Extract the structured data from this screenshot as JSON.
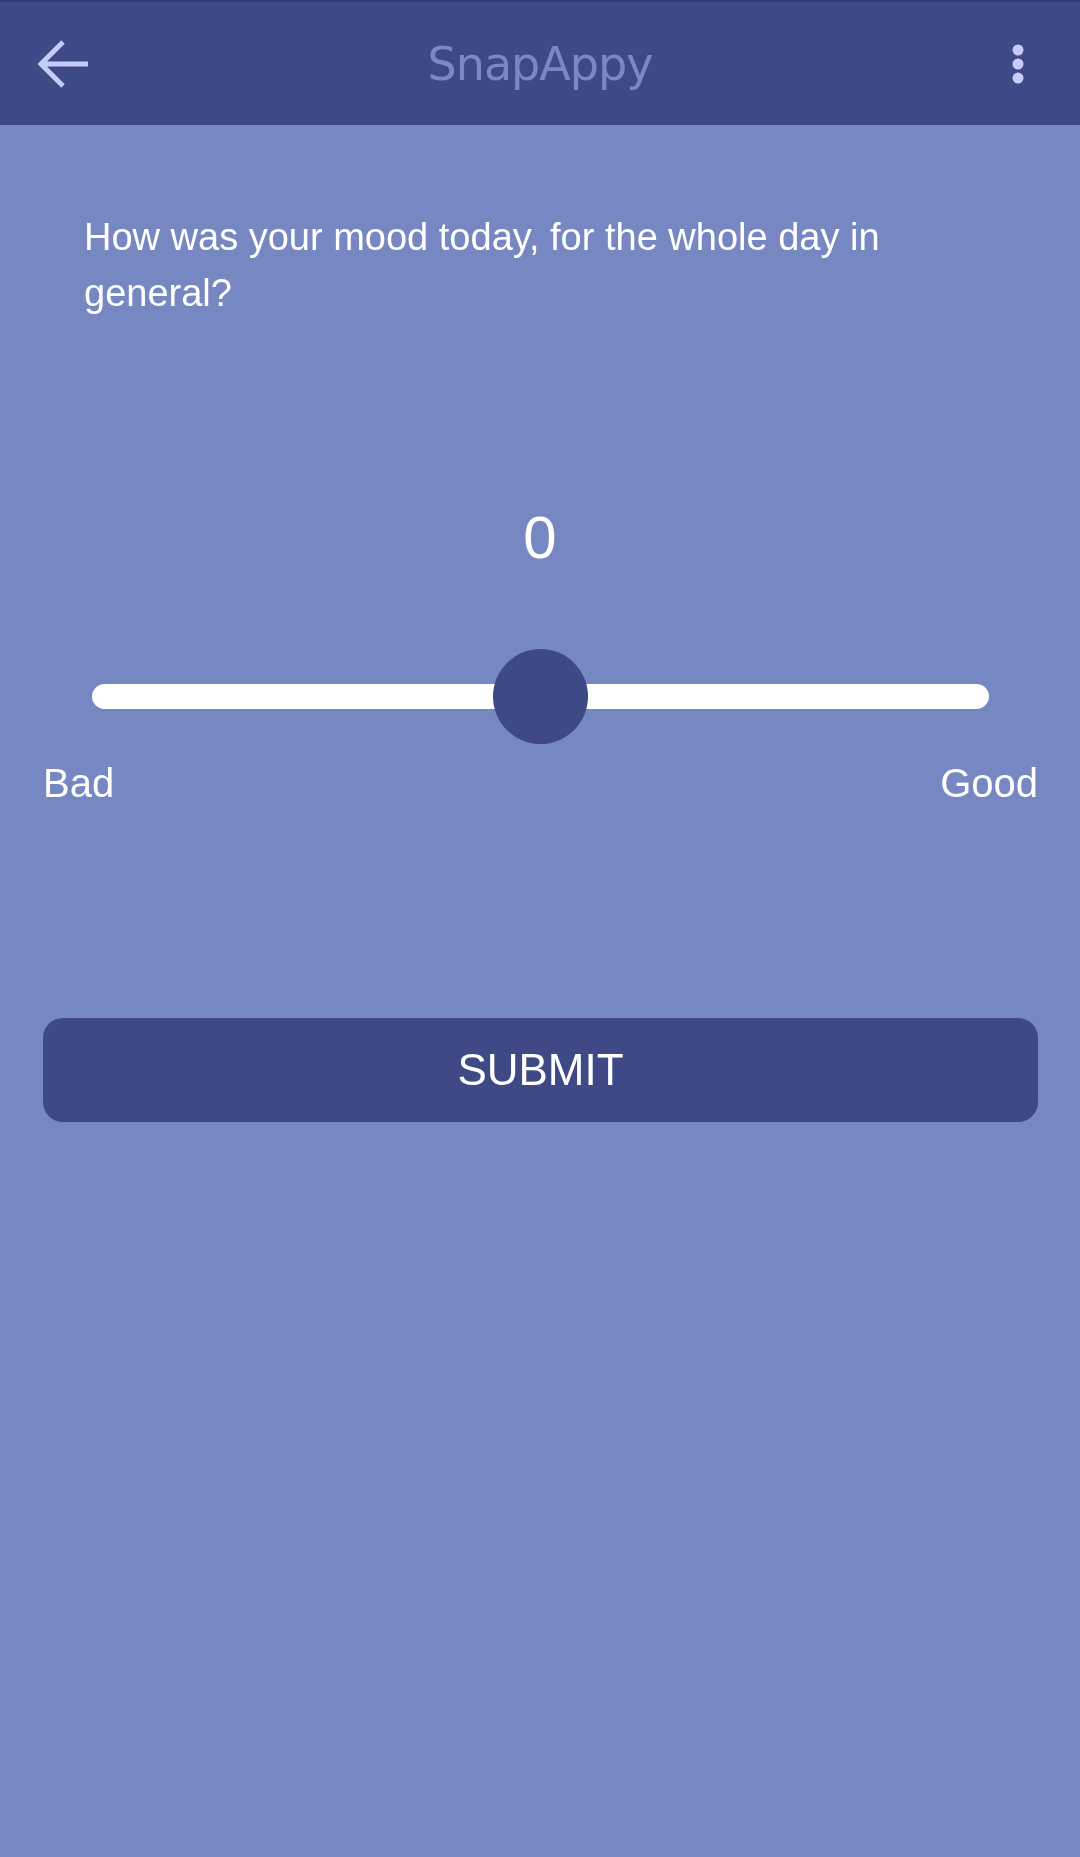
{
  "app_bar": {
    "title": "SnapAppy"
  },
  "question": "How was your mood today, for the whole day in general?",
  "slider": {
    "value": "0",
    "level": 0.5,
    "min_label": "Bad",
    "max_label": "Good"
  },
  "submit_button": {
    "label": "SUBMIT"
  }
}
